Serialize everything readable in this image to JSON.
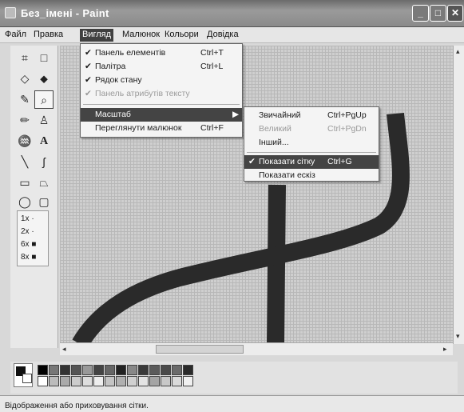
{
  "window": {
    "title": "Без_імені - Paint",
    "min": "_",
    "max": "□",
    "close": "✕"
  },
  "menubar": [
    "Файл",
    "Правка",
    "Вигляд",
    "Малюнок",
    "Кольори",
    "Довідка"
  ],
  "view_menu": {
    "items": [
      {
        "check": "✔",
        "label": "Панель елементів",
        "shortcut": "Ctrl+T"
      },
      {
        "check": "✔",
        "label": "Палітра",
        "shortcut": "Ctrl+L"
      },
      {
        "check": "✔",
        "label": "Рядок стану",
        "shortcut": ""
      },
      {
        "check": "✔",
        "label": "Панель атрибутів тексту",
        "shortcut": ""
      }
    ],
    "zoom": {
      "label": "Масштаб",
      "arrow": "▶"
    },
    "view_picture": {
      "label": "Переглянути малюнок",
      "shortcut": "Ctrl+F"
    }
  },
  "zoom_menu": {
    "normal": {
      "label": "Звичайний",
      "shortcut": "Ctrl+PgUp"
    },
    "large": {
      "label": "Великий",
      "shortcut": "Ctrl+PgDn"
    },
    "custom": {
      "label": "Інший..."
    },
    "grid": {
      "check": "✔",
      "label": "Показати сітку",
      "shortcut": "Ctrl+G"
    },
    "thumbnail": {
      "label": "Показати ескіз"
    }
  },
  "zoom_levels": [
    {
      "label": "1x",
      "mark": "·"
    },
    {
      "label": "2x",
      "mark": "·"
    },
    {
      "label": "6x",
      "mark": "■"
    },
    {
      "label": "8x",
      "mark": "■"
    }
  ],
  "tools": {
    "text": "A",
    "fill": "⬥",
    "select_free": "⌗",
    "select_rect": "□",
    "eraser": "◇",
    "picker": "✎",
    "magnifier": "⌕",
    "pencil": "✏",
    "brush": "♙",
    "airbrush": "♒",
    "line": "╲",
    "curve": "ʃ",
    "rect": "▭",
    "polygon": "⏢",
    "ellipse": "◯",
    "rounded_rect": "▢"
  },
  "status_bar": {
    "text": "Відображення або приховування сітки."
  },
  "scroll": {
    "left": "◂",
    "right": "▸",
    "up": "▴",
    "down": "▾"
  },
  "colors": {
    "accent": "#404040",
    "stroke": "#2a2a2a"
  }
}
